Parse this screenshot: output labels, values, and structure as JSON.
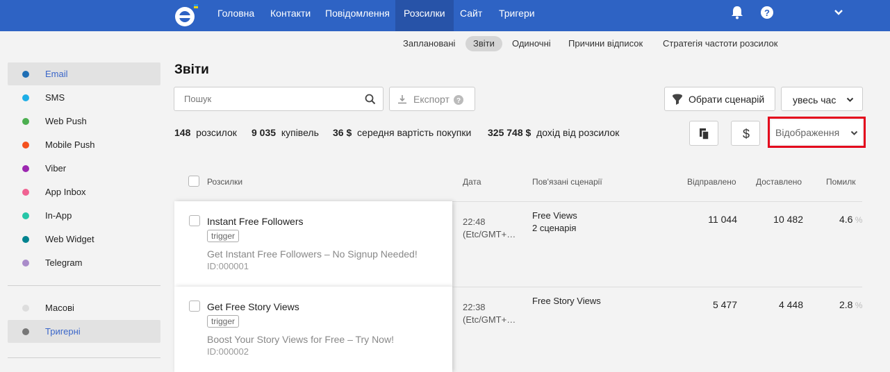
{
  "nav": {
    "items": [
      {
        "label": "Головна"
      },
      {
        "label": "Контакти"
      },
      {
        "label": "Повідомлення"
      },
      {
        "label": "Розсилки"
      },
      {
        "label": "Сайт"
      },
      {
        "label": "Тригери"
      }
    ],
    "active": "Розсилки"
  },
  "subnav": {
    "items": [
      {
        "label": "Заплановані"
      },
      {
        "label": "Звіти"
      },
      {
        "label": "Одиночні"
      },
      {
        "label": "Причини відписок"
      },
      {
        "label": "Стратегія частоти розсилок"
      }
    ],
    "active": "Звіти"
  },
  "sidebar": {
    "channels": [
      {
        "label": "Email",
        "color": "#1f6fb5"
      },
      {
        "label": "SMS",
        "color": "#1eaee6"
      },
      {
        "label": "Web Push",
        "color": "#4caf50"
      },
      {
        "label": "Mobile Push",
        "color": "#f4511e"
      },
      {
        "label": "Viber",
        "color": "#9c27b0"
      },
      {
        "label": "App Inbox",
        "color": "#f06292"
      },
      {
        "label": "In-App",
        "color": "#26c6a8"
      },
      {
        "label": "Web Widget",
        "color": "#00838f"
      },
      {
        "label": "Telegram",
        "color": "#a98bc9"
      }
    ],
    "types": [
      {
        "label": "Масові",
        "color": "#dddddd"
      },
      {
        "label": "Тригерні",
        "color": "#777777"
      }
    ]
  },
  "page": {
    "title": "Звіти"
  },
  "search": {
    "placeholder": "Пошук"
  },
  "toolbar": {
    "export_label": "Експорт",
    "scenario_label": "Обрати сценарій",
    "period_label": "увесь час",
    "display_label": "Відображення"
  },
  "stats": [
    {
      "value": "148",
      "label": "розсилок"
    },
    {
      "value": "9 035",
      "label": "купівель"
    },
    {
      "value": "36 $",
      "label": "середня вартість покупки"
    },
    {
      "value": "325 748 $",
      "label": "дохід від розсилок"
    }
  ],
  "table": {
    "headers": {
      "campaigns": "Розсилки",
      "date": "Дата",
      "scenarios": "Пов'язані сценарії",
      "sent": "Відправлено",
      "delivered": "Доставлено",
      "errors": "Помилк"
    },
    "rows": [
      {
        "name": "Instant Free Followers",
        "tag": "trigger",
        "subject": "Get Instant Free Followers – No Signup Needed!",
        "id": "ID:000001",
        "time": "22:48",
        "tz": "(Etc/GMT+…",
        "scenario": "Free Views",
        "scenario_count": "2 сценарія",
        "sent": "11 044",
        "delivered": "10 482",
        "errors": "4.6"
      },
      {
        "name": "Get Free Story Views",
        "tag": "trigger",
        "subject": "Boost Your Story Views for Free – Try Now!",
        "id": "ID:000002",
        "time": "22:38",
        "tz": "(Etc/GMT+…",
        "scenario": "Free Story Views",
        "scenario_count": "",
        "sent": "5 477",
        "delivered": "4 448",
        "errors": "2.8"
      }
    ]
  },
  "icons": {
    "bell": "bell-icon",
    "help": "help-icon",
    "chevron": "chevron-down-icon",
    "search": "search-icon",
    "download": "download-icon",
    "funnel": "funnel-icon",
    "copy": "copy-icon",
    "dollar": "dollar-icon"
  }
}
